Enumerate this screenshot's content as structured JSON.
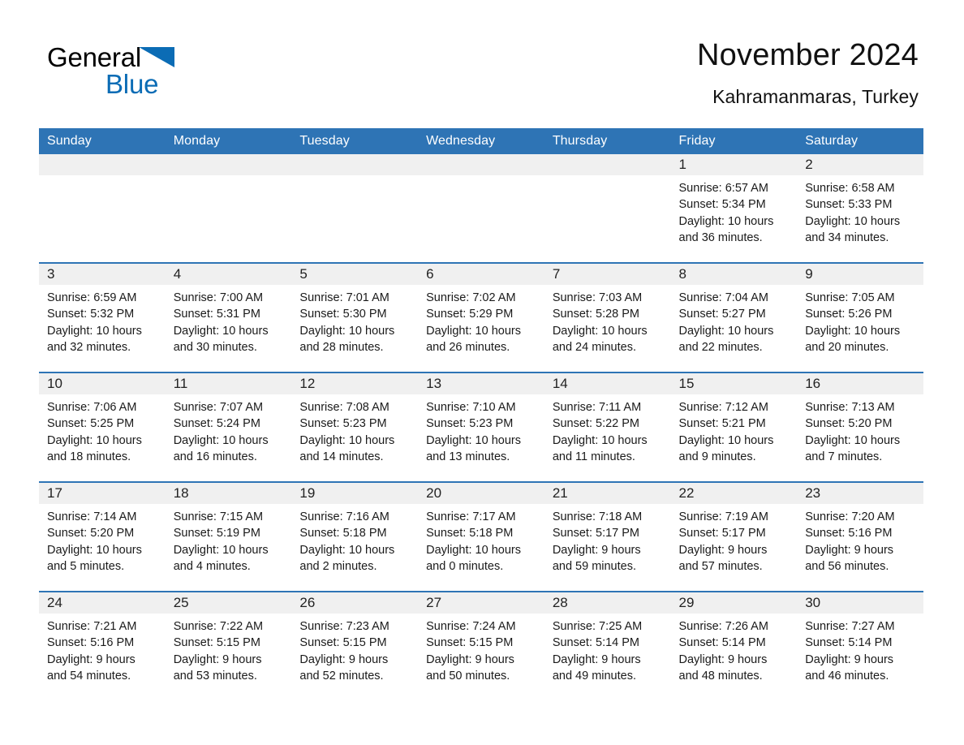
{
  "brand": {
    "name_part1": "General",
    "name_part2": "Blue",
    "triangle_color": "#0b6cb5"
  },
  "header": {
    "title": "November 2024",
    "subtitle": "Kahramanmaras, Turkey"
  },
  "theme": {
    "header_bg": "#2e74b5",
    "header_text": "#ffffff",
    "daynum_band_bg": "#f0f0f0",
    "row_divider": "#2e74b5",
    "page_bg": "#ffffff",
    "body_text": "#1a1a1a"
  },
  "calendar": {
    "weekday_headers": [
      "Sunday",
      "Monday",
      "Tuesday",
      "Wednesday",
      "Thursday",
      "Friday",
      "Saturday"
    ],
    "weeks": [
      [
        {
          "day": "",
          "empty": true
        },
        {
          "day": "",
          "empty": true
        },
        {
          "day": "",
          "empty": true
        },
        {
          "day": "",
          "empty": true
        },
        {
          "day": "",
          "empty": true
        },
        {
          "day": "1",
          "sunrise": "Sunrise: 6:57 AM",
          "sunset": "Sunset: 5:34 PM",
          "daylight": "Daylight: 10 hours and 36 minutes."
        },
        {
          "day": "2",
          "sunrise": "Sunrise: 6:58 AM",
          "sunset": "Sunset: 5:33 PM",
          "daylight": "Daylight: 10 hours and 34 minutes."
        }
      ],
      [
        {
          "day": "3",
          "sunrise": "Sunrise: 6:59 AM",
          "sunset": "Sunset: 5:32 PM",
          "daylight": "Daylight: 10 hours and 32 minutes."
        },
        {
          "day": "4",
          "sunrise": "Sunrise: 7:00 AM",
          "sunset": "Sunset: 5:31 PM",
          "daylight": "Daylight: 10 hours and 30 minutes."
        },
        {
          "day": "5",
          "sunrise": "Sunrise: 7:01 AM",
          "sunset": "Sunset: 5:30 PM",
          "daylight": "Daylight: 10 hours and 28 minutes."
        },
        {
          "day": "6",
          "sunrise": "Sunrise: 7:02 AM",
          "sunset": "Sunset: 5:29 PM",
          "daylight": "Daylight: 10 hours and 26 minutes."
        },
        {
          "day": "7",
          "sunrise": "Sunrise: 7:03 AM",
          "sunset": "Sunset: 5:28 PM",
          "daylight": "Daylight: 10 hours and 24 minutes."
        },
        {
          "day": "8",
          "sunrise": "Sunrise: 7:04 AM",
          "sunset": "Sunset: 5:27 PM",
          "daylight": "Daylight: 10 hours and 22 minutes."
        },
        {
          "day": "9",
          "sunrise": "Sunrise: 7:05 AM",
          "sunset": "Sunset: 5:26 PM",
          "daylight": "Daylight: 10 hours and 20 minutes."
        }
      ],
      [
        {
          "day": "10",
          "sunrise": "Sunrise: 7:06 AM",
          "sunset": "Sunset: 5:25 PM",
          "daylight": "Daylight: 10 hours and 18 minutes."
        },
        {
          "day": "11",
          "sunrise": "Sunrise: 7:07 AM",
          "sunset": "Sunset: 5:24 PM",
          "daylight": "Daylight: 10 hours and 16 minutes."
        },
        {
          "day": "12",
          "sunrise": "Sunrise: 7:08 AM",
          "sunset": "Sunset: 5:23 PM",
          "daylight": "Daylight: 10 hours and 14 minutes."
        },
        {
          "day": "13",
          "sunrise": "Sunrise: 7:10 AM",
          "sunset": "Sunset: 5:23 PM",
          "daylight": "Daylight: 10 hours and 13 minutes."
        },
        {
          "day": "14",
          "sunrise": "Sunrise: 7:11 AM",
          "sunset": "Sunset: 5:22 PM",
          "daylight": "Daylight: 10 hours and 11 minutes."
        },
        {
          "day": "15",
          "sunrise": "Sunrise: 7:12 AM",
          "sunset": "Sunset: 5:21 PM",
          "daylight": "Daylight: 10 hours and 9 minutes."
        },
        {
          "day": "16",
          "sunrise": "Sunrise: 7:13 AM",
          "sunset": "Sunset: 5:20 PM",
          "daylight": "Daylight: 10 hours and 7 minutes."
        }
      ],
      [
        {
          "day": "17",
          "sunrise": "Sunrise: 7:14 AM",
          "sunset": "Sunset: 5:20 PM",
          "daylight": "Daylight: 10 hours and 5 minutes."
        },
        {
          "day": "18",
          "sunrise": "Sunrise: 7:15 AM",
          "sunset": "Sunset: 5:19 PM",
          "daylight": "Daylight: 10 hours and 4 minutes."
        },
        {
          "day": "19",
          "sunrise": "Sunrise: 7:16 AM",
          "sunset": "Sunset: 5:18 PM",
          "daylight": "Daylight: 10 hours and 2 minutes."
        },
        {
          "day": "20",
          "sunrise": "Sunrise: 7:17 AM",
          "sunset": "Sunset: 5:18 PM",
          "daylight": "Daylight: 10 hours and 0 minutes."
        },
        {
          "day": "21",
          "sunrise": "Sunrise: 7:18 AM",
          "sunset": "Sunset: 5:17 PM",
          "daylight": "Daylight: 9 hours and 59 minutes."
        },
        {
          "day": "22",
          "sunrise": "Sunrise: 7:19 AM",
          "sunset": "Sunset: 5:17 PM",
          "daylight": "Daylight: 9 hours and 57 minutes."
        },
        {
          "day": "23",
          "sunrise": "Sunrise: 7:20 AM",
          "sunset": "Sunset: 5:16 PM",
          "daylight": "Daylight: 9 hours and 56 minutes."
        }
      ],
      [
        {
          "day": "24",
          "sunrise": "Sunrise: 7:21 AM",
          "sunset": "Sunset: 5:16 PM",
          "daylight": "Daylight: 9 hours and 54 minutes."
        },
        {
          "day": "25",
          "sunrise": "Sunrise: 7:22 AM",
          "sunset": "Sunset: 5:15 PM",
          "daylight": "Daylight: 9 hours and 53 minutes."
        },
        {
          "day": "26",
          "sunrise": "Sunrise: 7:23 AM",
          "sunset": "Sunset: 5:15 PM",
          "daylight": "Daylight: 9 hours and 52 minutes."
        },
        {
          "day": "27",
          "sunrise": "Sunrise: 7:24 AM",
          "sunset": "Sunset: 5:15 PM",
          "daylight": "Daylight: 9 hours and 50 minutes."
        },
        {
          "day": "28",
          "sunrise": "Sunrise: 7:25 AM",
          "sunset": "Sunset: 5:14 PM",
          "daylight": "Daylight: 9 hours and 49 minutes."
        },
        {
          "day": "29",
          "sunrise": "Sunrise: 7:26 AM",
          "sunset": "Sunset: 5:14 PM",
          "daylight": "Daylight: 9 hours and 48 minutes."
        },
        {
          "day": "30",
          "sunrise": "Sunrise: 7:27 AM",
          "sunset": "Sunset: 5:14 PM",
          "daylight": "Daylight: 9 hours and 46 minutes."
        }
      ]
    ]
  }
}
